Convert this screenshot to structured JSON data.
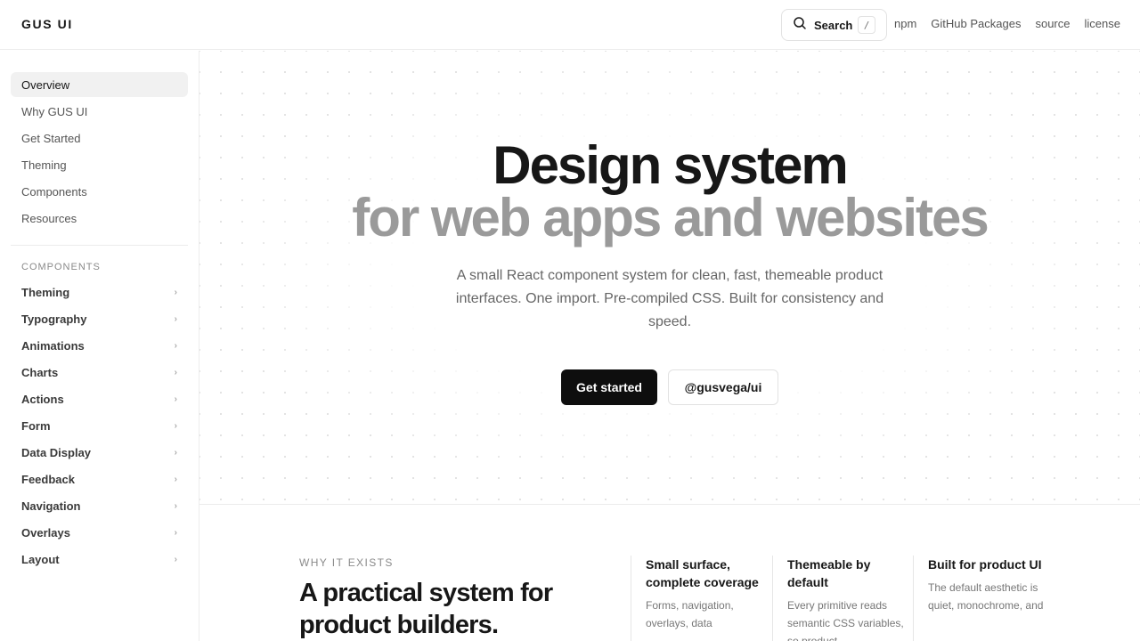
{
  "header": {
    "brand": "GUS UI",
    "search_label": "Search",
    "search_shortcut": "/",
    "links": [
      "npm",
      "GitHub Packages",
      "source",
      "license"
    ]
  },
  "sidebar": {
    "items": [
      {
        "label": "Overview",
        "active": true
      },
      {
        "label": "Why GUS UI"
      },
      {
        "label": "Get Started"
      },
      {
        "label": "Theming"
      },
      {
        "label": "Components"
      },
      {
        "label": "Resources"
      }
    ],
    "section_label": "COMPONENTS",
    "components": [
      "Theming",
      "Typography",
      "Animations",
      "Charts",
      "Actions",
      "Form",
      "Data Display",
      "Feedback",
      "Navigation",
      "Overlays",
      "Layout"
    ],
    "chevron": "›"
  },
  "hero": {
    "title_line1": "Design system",
    "title_line2": "for web apps and websites",
    "lead": "A small React component system for clean, fast, themeable product interfaces. One import. Pre-compiled CSS. Built for consistency and speed.",
    "primary_cta": "Get started",
    "secondary_cta": "@gusvega/ui"
  },
  "why": {
    "eyebrow": "WHY IT EXISTS",
    "title": "A practical system for product builders.",
    "features": [
      {
        "title": "Small surface, complete coverage",
        "body": "Forms, navigation, overlays, data"
      },
      {
        "title": "Themeable by default",
        "body": "Every primitive reads semantic CSS variables, so product"
      },
      {
        "title": "Built for product UI",
        "body": "The default aesthetic is quiet, monochrome, and"
      }
    ]
  },
  "colors": {
    "accent": "#0e0e0e",
    "muted_title": "#9a9a9a",
    "active_nav_bg": "#f1f1f1"
  }
}
